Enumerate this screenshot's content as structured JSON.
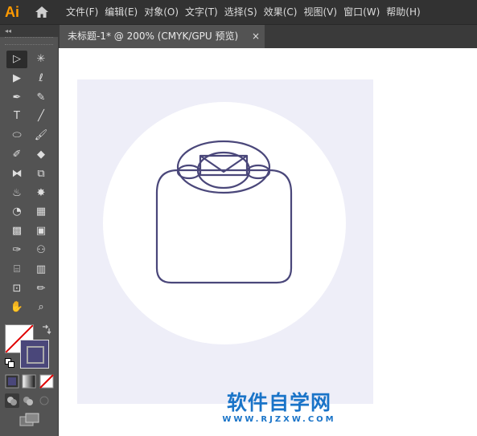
{
  "app": {
    "logo": "Ai"
  },
  "menu": [
    "文件(F)",
    "编辑(E)",
    "对象(O)",
    "文字(T)",
    "选择(S)",
    "效果(C)",
    "视图(V)",
    "窗口(W)",
    "帮助(H)"
  ],
  "document_tab": {
    "title": "未标题-1* @ 200% (CMYK/GPU 预览)",
    "close": "×"
  },
  "panel_collapse": "◂◂",
  "tools": [
    {
      "name": "selection-tool-icon",
      "glyph": "▷"
    },
    {
      "name": "magic-wand-tool-icon",
      "glyph": "✳"
    },
    {
      "name": "direct-selection-tool-icon",
      "glyph": "▶"
    },
    {
      "name": "lasso-tool-icon",
      "glyph": "ℓ"
    },
    {
      "name": "pen-tool-icon",
      "glyph": "✒"
    },
    {
      "name": "curvature-tool-icon",
      "glyph": "✎"
    },
    {
      "name": "type-tool-icon",
      "glyph": "T"
    },
    {
      "name": "line-tool-icon",
      "glyph": "╱"
    },
    {
      "name": "ellipse-tool-icon",
      "glyph": "⬭"
    },
    {
      "name": "paintbrush-tool-icon",
      "glyph": "🖌"
    },
    {
      "name": "shaper-tool-icon",
      "glyph": "✐"
    },
    {
      "name": "eraser-tool-icon",
      "glyph": "◆"
    },
    {
      "name": "reflect-tool-icon",
      "glyph": "⧓"
    },
    {
      "name": "scale-tool-icon",
      "glyph": "⧉"
    },
    {
      "name": "warp-tool-icon",
      "glyph": "♨"
    },
    {
      "name": "puppet-warp-tool-icon",
      "glyph": "✸"
    },
    {
      "name": "shape-builder-tool-icon",
      "glyph": "◔"
    },
    {
      "name": "perspective-grid-tool-icon",
      "glyph": "▦"
    },
    {
      "name": "mesh-tool-icon",
      "glyph": "▩"
    },
    {
      "name": "gradient-tool-icon",
      "glyph": "▣"
    },
    {
      "name": "eyedropper-tool-icon",
      "glyph": "✑"
    },
    {
      "name": "blend-tool-icon",
      "glyph": "⚇"
    },
    {
      "name": "symbol-sprayer-tool-icon",
      "glyph": "⌸"
    },
    {
      "name": "column-graph-tool-icon",
      "glyph": "▥"
    },
    {
      "name": "artboard-tool-icon",
      "glyph": "⊡"
    },
    {
      "name": "slice-tool-icon",
      "glyph": "✏"
    },
    {
      "name": "hand-tool-icon",
      "glyph": "✋"
    },
    {
      "name": "zoom-tool-icon",
      "glyph": "⌕"
    }
  ],
  "colors": {
    "stroke_swatch": "#4a477a",
    "artboard_bg": "#eeeef8",
    "circle": "#ffffff",
    "drawing_stroke": "#4a477a",
    "watermark": "#1a74c8"
  },
  "watermark": {
    "main": "软件自学网",
    "sub": "WWW.RJZXW.COM"
  }
}
